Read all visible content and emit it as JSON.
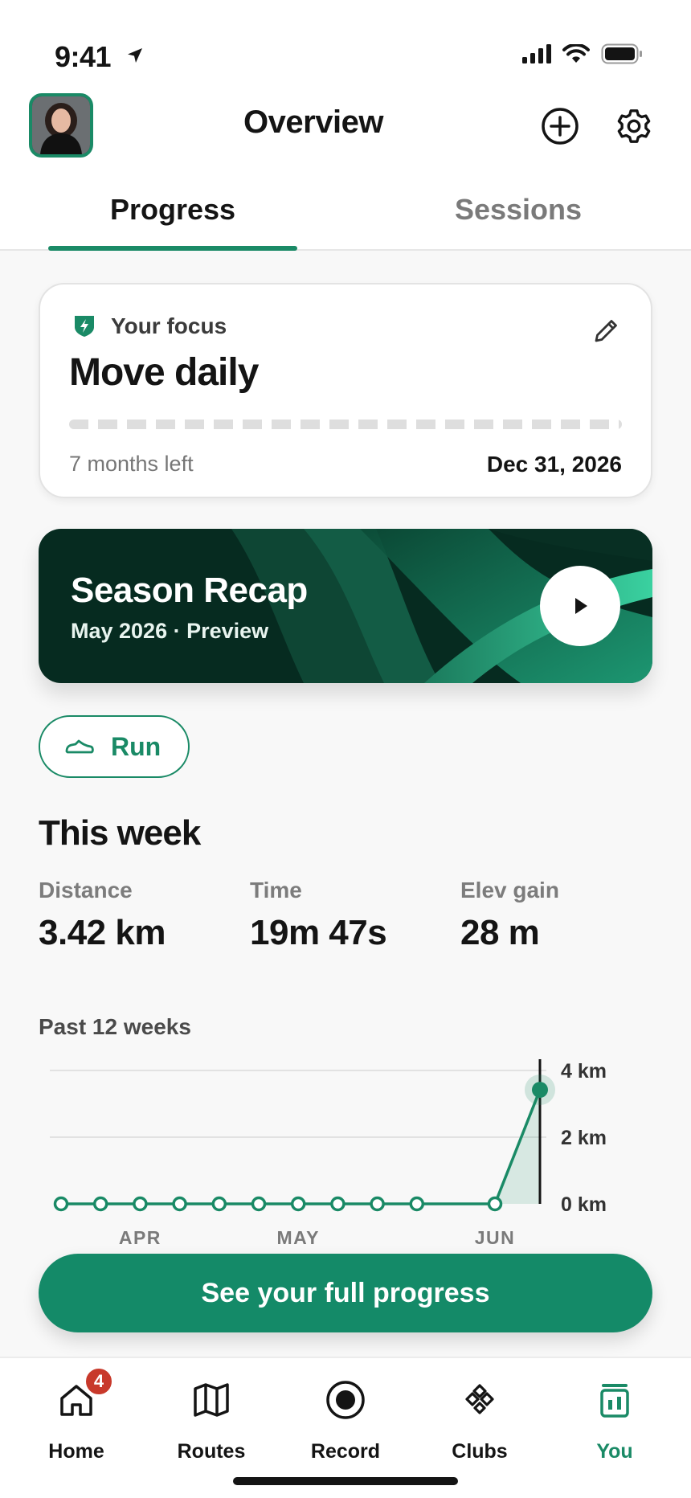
{
  "status_bar": {
    "time": "9:41"
  },
  "header": {
    "title": "Overview"
  },
  "tabs": [
    {
      "label": "Progress",
      "active": true
    },
    {
      "label": "Sessions",
      "active": false
    }
  ],
  "focus": {
    "label": "Your focus",
    "title": "Move daily",
    "remaining": "7 months left",
    "end_date": "Dec 31, 2026",
    "progress": 0
  },
  "recap": {
    "title": "Season Recap",
    "subtitle": "May 2026 · Preview"
  },
  "activity_filter": {
    "label": "Run",
    "icon": "shoe-icon"
  },
  "this_week": {
    "title": "This week",
    "stats": [
      {
        "label": "Distance",
        "value": "3.42 km"
      },
      {
        "label": "Time",
        "value": "19m 47s"
      },
      {
        "label": "Elev gain",
        "value": "28 m"
      }
    ]
  },
  "chart_title": "Past 12 weeks",
  "chart_data": {
    "type": "line",
    "title": "Past 12 weeks",
    "x": [
      1,
      2,
      3,
      4,
      5,
      6,
      7,
      8,
      9,
      10,
      11,
      12
    ],
    "month_labels": [
      {
        "label": "APR",
        "week": 3
      },
      {
        "label": "MAY",
        "week": 7
      },
      {
        "label": "JUN",
        "week": 11
      }
    ],
    "series": [
      {
        "values": [
          0,
          0,
          0,
          0,
          0,
          0,
          0,
          0,
          0,
          0,
          0,
          3.42
        ]
      }
    ],
    "y_ticks": [
      "0 km",
      "2 km",
      "4 km"
    ],
    "ylim": [
      0,
      4
    ],
    "grid": true,
    "highlight_index": 11,
    "color": "#1a8a66"
  },
  "cta": {
    "label": "See your full progress"
  },
  "tabbar": {
    "items": [
      {
        "label": "Home",
        "icon": "home-icon",
        "badge": "4"
      },
      {
        "label": "Routes",
        "icon": "map-icon"
      },
      {
        "label": "Record",
        "icon": "record-icon"
      },
      {
        "label": "Clubs",
        "icon": "clubs-icon"
      },
      {
        "label": "You",
        "icon": "you-icon",
        "active": true
      }
    ]
  },
  "colors": {
    "accent": "#1a8a66",
    "badge": "#c8392b",
    "recap_bg": "#062b20"
  }
}
